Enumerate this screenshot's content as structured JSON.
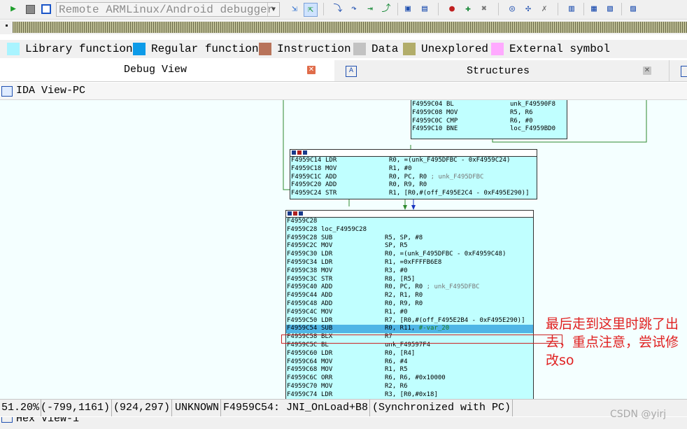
{
  "toolbar": {
    "debugger_select": "Remote ARMLinux/Android debugger",
    "icons": [
      "play-icon",
      "pause-icon",
      "stop-icon",
      "attach-icon",
      "detach-icon",
      "step-into-icon",
      "step-over-icon",
      "run-to-cursor-icon",
      "step-out-icon",
      "window-icon",
      "window-icon",
      "breakpoint-icon",
      "add-breakpoint-icon",
      "delete-breakpoint-icon",
      "watch-icon",
      "add-watch-icon",
      "delete-watch-icon",
      "trace-icon",
      "trace-icon",
      "trace-icon",
      "trace-icon"
    ]
  },
  "legend": [
    {
      "label": "Library function",
      "color": "#a9f4ff"
    },
    {
      "label": "Regular function",
      "color": "#0d9be8"
    },
    {
      "label": "Instruction",
      "color": "#b8735a"
    },
    {
      "label": "Data",
      "color": "#c2c2c2"
    },
    {
      "label": "Unexplored",
      "color": "#b2ad6a"
    },
    {
      "label": "External symbol",
      "color": "#ffaaff"
    }
  ],
  "tabs": [
    {
      "label": "Debug View"
    },
    {
      "label": "Structures"
    }
  ],
  "view_title": "IDA View-PC",
  "blocks": {
    "top": [
      [
        "F4959C04",
        "BL",
        "unk_F49590F8",
        ""
      ],
      [
        "F4959C08",
        "MOV",
        "R5, R6",
        ""
      ],
      [
        "F4959C0C",
        "CMP",
        "R6, #0",
        ""
      ],
      [
        "F4959C10",
        "BNE",
        "loc_F4959BD0",
        ""
      ]
    ],
    "middle": [
      [
        "F4959C14",
        "LDR",
        "R0, =(unk_F495DFBC - 0xF4959C24)",
        ""
      ],
      [
        "F4959C18",
        "MOV",
        "R1, #0",
        ""
      ],
      [
        "F4959C1C",
        "ADD",
        "R0, PC, R0",
        "; unk_F495DFBC"
      ],
      [
        "F4959C20",
        "ADD",
        "R0, R9, R0",
        ""
      ],
      [
        "F4959C24",
        "STR",
        "R1, [R0,#(off_F495E2C4 - 0xF495E290)]",
        ""
      ]
    ],
    "bottom": [
      [
        "F4959C28",
        "",
        "",
        ""
      ],
      [
        "F4959C28",
        "loc_F4959C28",
        "",
        ""
      ],
      [
        "F4959C28",
        "SUB",
        "R5, SP, #8",
        ""
      ],
      [
        "F4959C2C",
        "MOV",
        "SP, R5",
        ""
      ],
      [
        "F4959C30",
        "LDR",
        "R0, =(unk_F495DFBC - 0xF4959C48)",
        ""
      ],
      [
        "F4959C34",
        "LDR",
        "R1, =0xFFFFB6E8",
        ""
      ],
      [
        "F4959C38",
        "MOV",
        "R3, #0",
        ""
      ],
      [
        "F4959C3C",
        "STR",
        "R8, [R5]",
        ""
      ],
      [
        "F4959C40",
        "ADD",
        "R0, PC, R0",
        "; unk_F495DFBC"
      ],
      [
        "F4959C44",
        "ADD",
        "R2, R1, R0",
        ""
      ],
      [
        "F4959C48",
        "ADD",
        "R0, R9, R0",
        ""
      ],
      [
        "F4959C4C",
        "MOV",
        "R1, #0",
        ""
      ],
      [
        "F4959C50",
        "LDR",
        "R7, [R0,#(off_F495E2B4 - 0xF495E290)]",
        ""
      ],
      [
        "F4959C54",
        "SUB",
        "R0, R11, ",
        "#-var_20"
      ],
      [
        "F4959C58",
        "BLX",
        "R7",
        ""
      ],
      [
        "F4959C5C",
        "BL",
        "unk_F49597F4",
        ""
      ],
      [
        "F4959C60",
        "LDR",
        "R0, [R4]",
        ""
      ],
      [
        "F4959C64",
        "MOV",
        "R6, #4",
        ""
      ],
      [
        "F4959C68",
        "MOV",
        "R1, R5",
        ""
      ],
      [
        "F4959C6C",
        "ORR",
        "R6, R6, #0x10000",
        ""
      ],
      [
        "F4959C70",
        "MOV",
        "R2, R6",
        ""
      ],
      [
        "F4959C74",
        "LDR",
        "R3, [R0,#0x18]",
        ""
      ]
    ]
  },
  "annotation": "最后走到这里时跳了出去，重点注意，尝试修改so",
  "status": {
    "zoom": "51.20%",
    "coords1": "(-799,1161)",
    "coords2": "(924,297)",
    "segment": "UNKNOWN",
    "location": "F4959C54: JNI_OnLoad+B8",
    "sync": "(Synchronized with PC)"
  },
  "hex_title": "Hex View-1",
  "watermark": "CSDN @yirj"
}
